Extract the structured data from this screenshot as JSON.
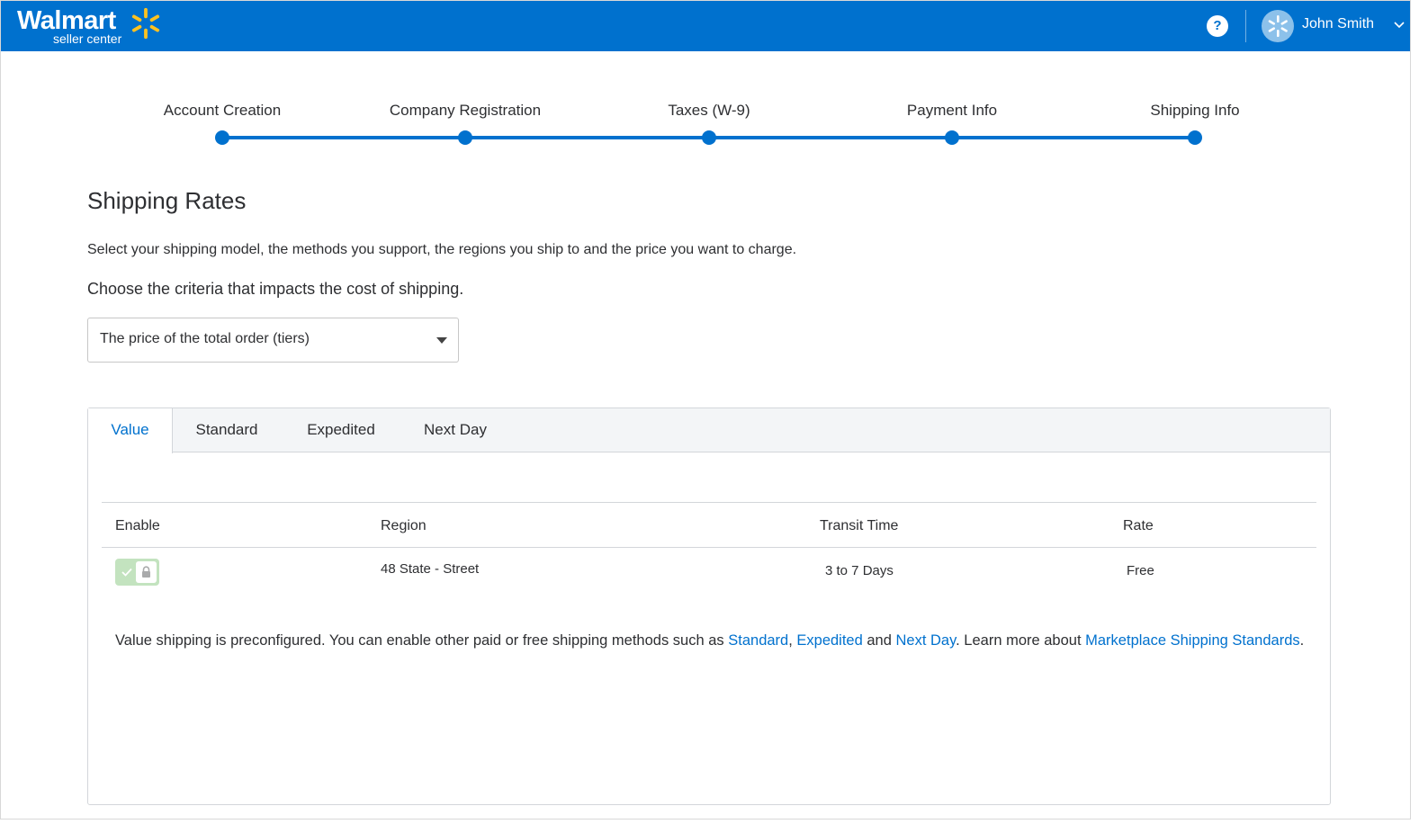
{
  "header": {
    "brand": "Walmart",
    "brand_sub": "seller center",
    "help_label": "?",
    "user_name": "John Smith",
    "brand_color": "#0071ce",
    "spark_color": "#ffc220"
  },
  "stepper": {
    "steps": [
      {
        "label": "Account Creation"
      },
      {
        "label": "Company Registration"
      },
      {
        "label": "Taxes (W-9)"
      },
      {
        "label": "Payment Info"
      },
      {
        "label": "Shipping Info"
      }
    ]
  },
  "page": {
    "title": "Shipping Rates",
    "description": "Select your shipping model, the methods you support, the regions you ship to and the price you want to charge.",
    "criteria_prompt": "Choose the criteria that impacts the cost of shipping.",
    "criteria_select": {
      "value": "The price of the total order (tiers)"
    }
  },
  "tabs": [
    {
      "label": "Value",
      "active": true
    },
    {
      "label": "Standard",
      "active": false
    },
    {
      "label": "Expedited",
      "active": false
    },
    {
      "label": "Next Day",
      "active": false
    }
  ],
  "table": {
    "headers": {
      "enable": "Enable",
      "region": "Region",
      "transit": "Transit Time",
      "rate": "Rate"
    },
    "rows": [
      {
        "enabled": true,
        "locked": true,
        "region": "48 State - Street",
        "transit": "3 to 7 Days",
        "rate": "Free"
      }
    ]
  },
  "note": {
    "text1": "Value shipping is preconfigured. You can enable other paid or free shipping methods such as ",
    "link_standard": "Standard",
    "sep1": ", ",
    "link_expedited": "Expedited",
    "sep2": " and ",
    "link_nextday": "Next Day",
    "text2": ". Learn more about ",
    "link_standards": "Marketplace Shipping Standards",
    "text3": "."
  }
}
